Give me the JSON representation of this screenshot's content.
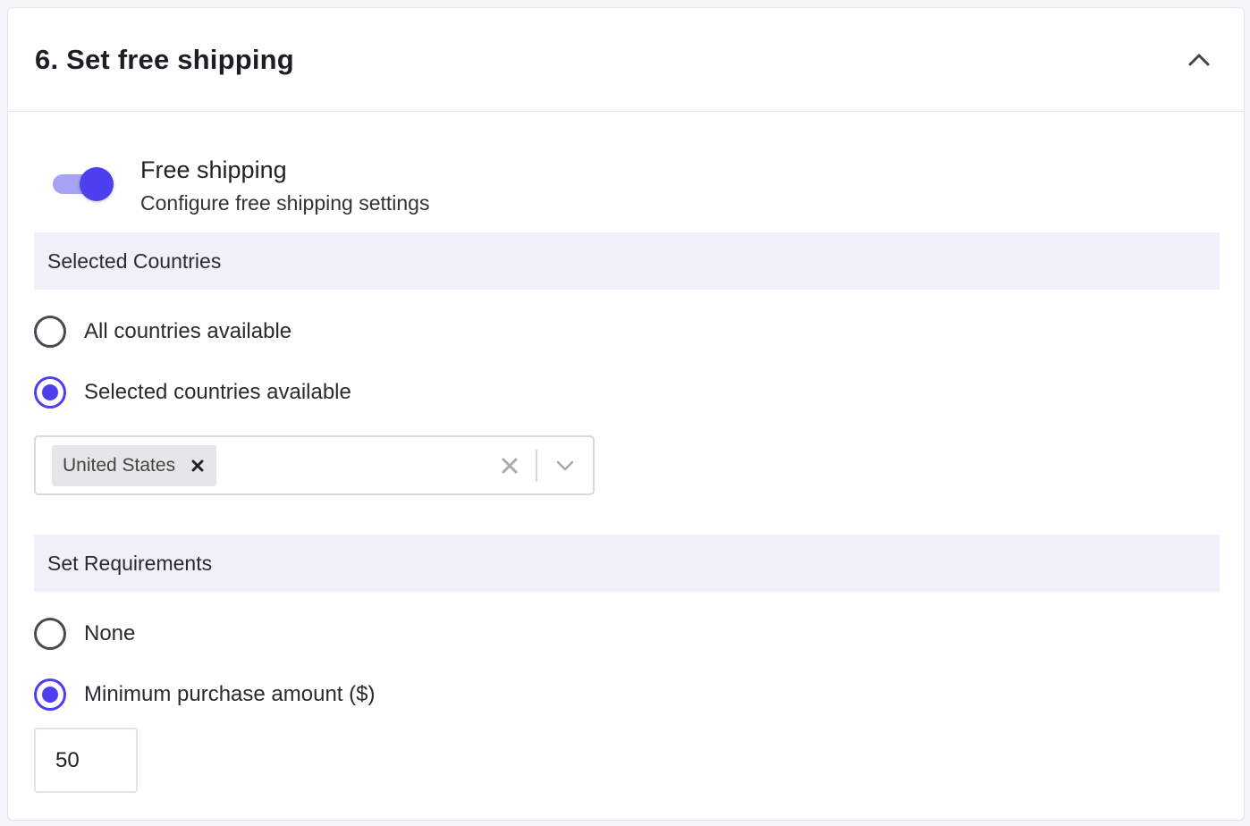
{
  "header": {
    "title": "6. Set free shipping"
  },
  "free_shipping": {
    "enabled": true,
    "title": "Free shipping",
    "subtitle": "Configure free shipping settings"
  },
  "countries": {
    "section_label": "Selected Countries",
    "options": [
      {
        "label": "All countries available",
        "checked": false
      },
      {
        "label": "Selected countries available",
        "checked": true
      }
    ],
    "selected": [
      "United States"
    ]
  },
  "requirements": {
    "section_label": "Set Requirements",
    "options": [
      {
        "label": "None",
        "checked": false
      },
      {
        "label": "Minimum purchase amount ($)",
        "checked": true
      }
    ],
    "min_amount": "50"
  },
  "colors": {
    "accent": "#4b3ff0",
    "accent_light": "#a7a2f1",
    "section_band": "#f0f0fb"
  },
  "icons": [
    "chevron-up-icon",
    "close-icon",
    "clear-icon",
    "chevron-down-icon"
  ]
}
